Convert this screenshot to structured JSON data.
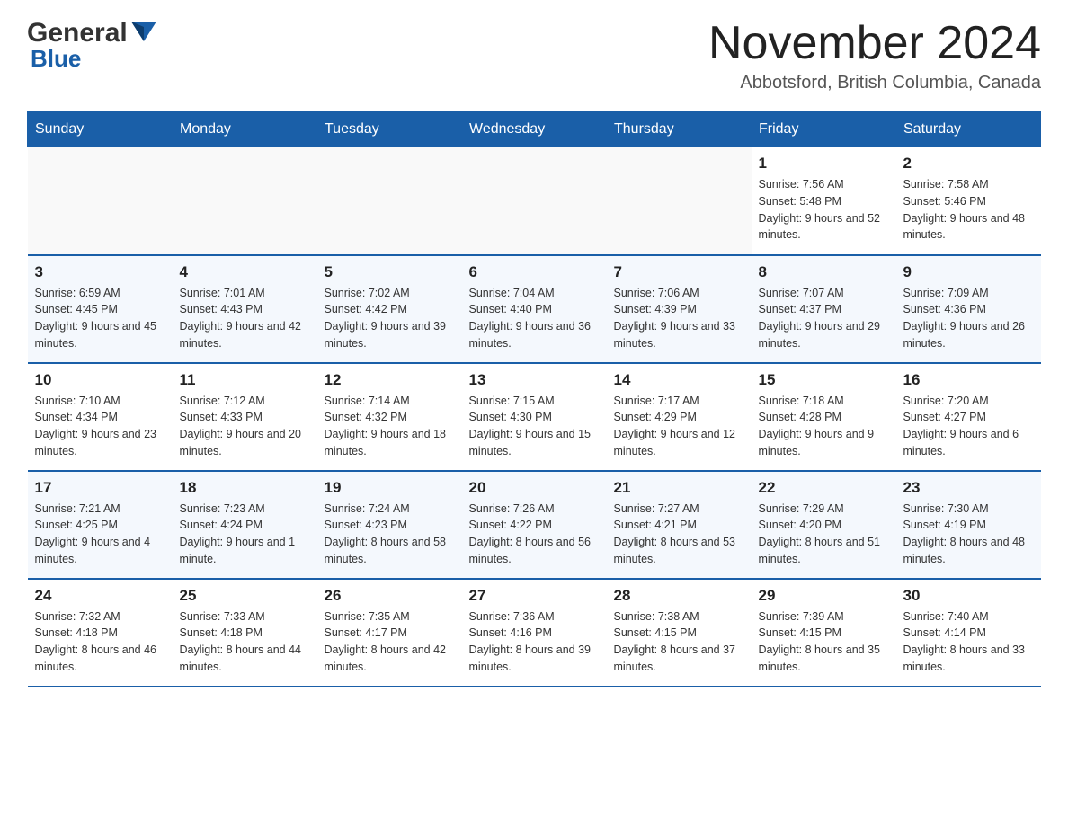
{
  "header": {
    "logo_general": "General",
    "logo_blue": "Blue",
    "month_title": "November 2024",
    "location": "Abbotsford, British Columbia, Canada"
  },
  "calendar": {
    "days_of_week": [
      "Sunday",
      "Monday",
      "Tuesday",
      "Wednesday",
      "Thursday",
      "Friday",
      "Saturday"
    ],
    "weeks": [
      [
        {
          "day": "",
          "info": ""
        },
        {
          "day": "",
          "info": ""
        },
        {
          "day": "",
          "info": ""
        },
        {
          "day": "",
          "info": ""
        },
        {
          "day": "",
          "info": ""
        },
        {
          "day": "1",
          "info": "Sunrise: 7:56 AM\nSunset: 5:48 PM\nDaylight: 9 hours and 52 minutes."
        },
        {
          "day": "2",
          "info": "Sunrise: 7:58 AM\nSunset: 5:46 PM\nDaylight: 9 hours and 48 minutes."
        }
      ],
      [
        {
          "day": "3",
          "info": "Sunrise: 6:59 AM\nSunset: 4:45 PM\nDaylight: 9 hours and 45 minutes."
        },
        {
          "day": "4",
          "info": "Sunrise: 7:01 AM\nSunset: 4:43 PM\nDaylight: 9 hours and 42 minutes."
        },
        {
          "day": "5",
          "info": "Sunrise: 7:02 AM\nSunset: 4:42 PM\nDaylight: 9 hours and 39 minutes."
        },
        {
          "day": "6",
          "info": "Sunrise: 7:04 AM\nSunset: 4:40 PM\nDaylight: 9 hours and 36 minutes."
        },
        {
          "day": "7",
          "info": "Sunrise: 7:06 AM\nSunset: 4:39 PM\nDaylight: 9 hours and 33 minutes."
        },
        {
          "day": "8",
          "info": "Sunrise: 7:07 AM\nSunset: 4:37 PM\nDaylight: 9 hours and 29 minutes."
        },
        {
          "day": "9",
          "info": "Sunrise: 7:09 AM\nSunset: 4:36 PM\nDaylight: 9 hours and 26 minutes."
        }
      ],
      [
        {
          "day": "10",
          "info": "Sunrise: 7:10 AM\nSunset: 4:34 PM\nDaylight: 9 hours and 23 minutes."
        },
        {
          "day": "11",
          "info": "Sunrise: 7:12 AM\nSunset: 4:33 PM\nDaylight: 9 hours and 20 minutes."
        },
        {
          "day": "12",
          "info": "Sunrise: 7:14 AM\nSunset: 4:32 PM\nDaylight: 9 hours and 18 minutes."
        },
        {
          "day": "13",
          "info": "Sunrise: 7:15 AM\nSunset: 4:30 PM\nDaylight: 9 hours and 15 minutes."
        },
        {
          "day": "14",
          "info": "Sunrise: 7:17 AM\nSunset: 4:29 PM\nDaylight: 9 hours and 12 minutes."
        },
        {
          "day": "15",
          "info": "Sunrise: 7:18 AM\nSunset: 4:28 PM\nDaylight: 9 hours and 9 minutes."
        },
        {
          "day": "16",
          "info": "Sunrise: 7:20 AM\nSunset: 4:27 PM\nDaylight: 9 hours and 6 minutes."
        }
      ],
      [
        {
          "day": "17",
          "info": "Sunrise: 7:21 AM\nSunset: 4:25 PM\nDaylight: 9 hours and 4 minutes."
        },
        {
          "day": "18",
          "info": "Sunrise: 7:23 AM\nSunset: 4:24 PM\nDaylight: 9 hours and 1 minute."
        },
        {
          "day": "19",
          "info": "Sunrise: 7:24 AM\nSunset: 4:23 PM\nDaylight: 8 hours and 58 minutes."
        },
        {
          "day": "20",
          "info": "Sunrise: 7:26 AM\nSunset: 4:22 PM\nDaylight: 8 hours and 56 minutes."
        },
        {
          "day": "21",
          "info": "Sunrise: 7:27 AM\nSunset: 4:21 PM\nDaylight: 8 hours and 53 minutes."
        },
        {
          "day": "22",
          "info": "Sunrise: 7:29 AM\nSunset: 4:20 PM\nDaylight: 8 hours and 51 minutes."
        },
        {
          "day": "23",
          "info": "Sunrise: 7:30 AM\nSunset: 4:19 PM\nDaylight: 8 hours and 48 minutes."
        }
      ],
      [
        {
          "day": "24",
          "info": "Sunrise: 7:32 AM\nSunset: 4:18 PM\nDaylight: 8 hours and 46 minutes."
        },
        {
          "day": "25",
          "info": "Sunrise: 7:33 AM\nSunset: 4:18 PM\nDaylight: 8 hours and 44 minutes."
        },
        {
          "day": "26",
          "info": "Sunrise: 7:35 AM\nSunset: 4:17 PM\nDaylight: 8 hours and 42 minutes."
        },
        {
          "day": "27",
          "info": "Sunrise: 7:36 AM\nSunset: 4:16 PM\nDaylight: 8 hours and 39 minutes."
        },
        {
          "day": "28",
          "info": "Sunrise: 7:38 AM\nSunset: 4:15 PM\nDaylight: 8 hours and 37 minutes."
        },
        {
          "day": "29",
          "info": "Sunrise: 7:39 AM\nSunset: 4:15 PM\nDaylight: 8 hours and 35 minutes."
        },
        {
          "day": "30",
          "info": "Sunrise: 7:40 AM\nSunset: 4:14 PM\nDaylight: 8 hours and 33 minutes."
        }
      ]
    ]
  }
}
